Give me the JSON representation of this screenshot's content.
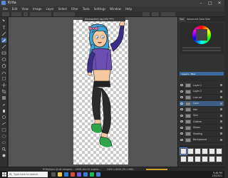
{
  "window": {
    "title": "Krita",
    "controls": [
      "–",
      "□",
      "✕"
    ]
  },
  "menubar": {
    "items": [
      "File",
      "Edit",
      "View",
      "Image",
      "Layer",
      "Select",
      "Filter",
      "Tools",
      "Settings",
      "Window",
      "Help"
    ]
  },
  "document": {
    "tab_label": "[character] ng (0% ***)"
  },
  "docker": {
    "tabs": [
      "Tool",
      "Advanced Color Sele"
    ],
    "layers_title": "Layers - Misc",
    "layers": [
      {
        "name": "Layer 1"
      },
      {
        "name": "Layer 2"
      },
      {
        "name": "Line art"
      },
      {
        "name": "Color"
      },
      {
        "name": "Hair"
      },
      {
        "name": "Skin"
      },
      {
        "name": "Clothes"
      },
      {
        "name": "Shoes"
      },
      {
        "name": "Shading"
      },
      {
        "name": "Background"
      }
    ],
    "selected_layer_index": 3,
    "brush_presets_title": "Brush Presets"
  },
  "statusbar": {
    "left_text": "RGB/Alpha (8-bit integer/c...  sRGB-elle-V2-srgbtrc...",
    "right_text": "2400 x 6000 (35.1 MiB)"
  },
  "taskbar": {
    "search_placeholder": "Type here to search",
    "time": "9:46 PM",
    "date": "2/5/2021"
  }
}
